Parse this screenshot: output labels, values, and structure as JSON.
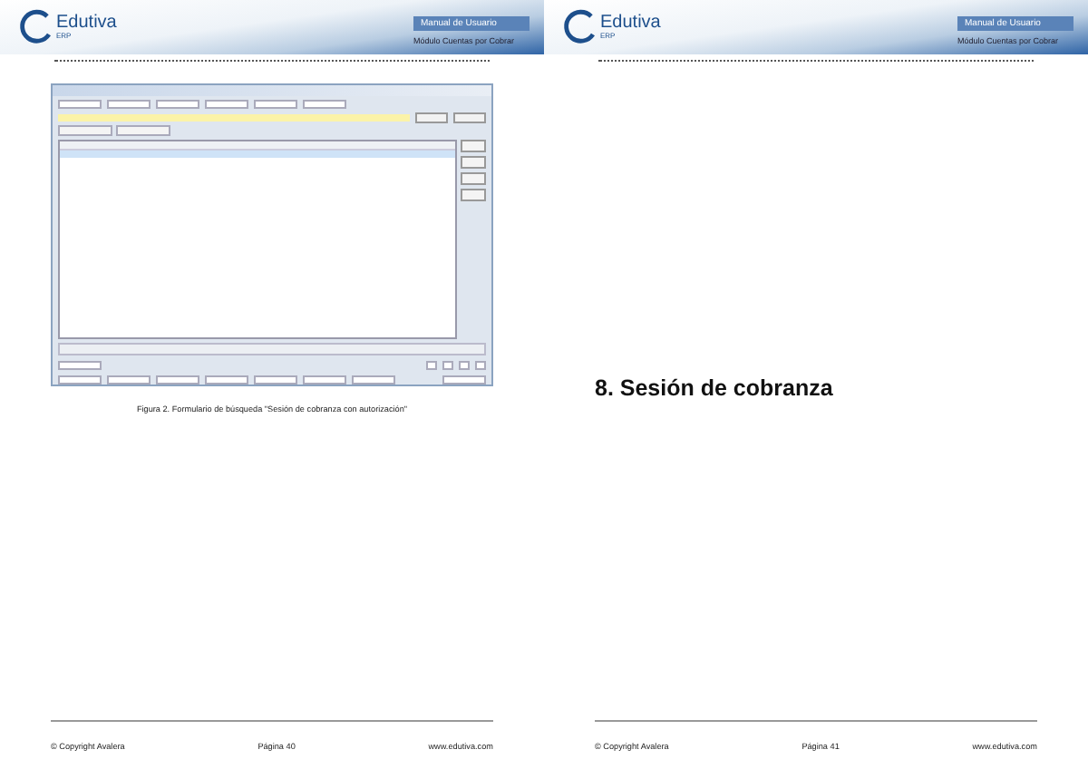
{
  "pages": [
    {
      "header": {
        "logo": "Edutiva",
        "logo_sub": "ERP",
        "title": "Manual de Usuario",
        "subtitle": "Módulo Cuentas por Cobrar"
      },
      "figure": {
        "caption": "Figura 2. Formulario de búsqueda \"Sesión de cobranza con autorización\""
      },
      "footer": {
        "copyright": "© Copyright Avalera",
        "page": "Página 40",
        "url": "www.edutiva.com"
      }
    },
    {
      "header": {
        "logo": "Edutiva",
        "logo_sub": "ERP",
        "title": "Manual de Usuario",
        "subtitle": "Módulo Cuentas por Cobrar"
      },
      "heading": "8. Sesión de cobranza",
      "footer": {
        "copyright": "© Copyright Avalera",
        "page": "Página 41",
        "url": "www.edutiva.com"
      }
    }
  ]
}
